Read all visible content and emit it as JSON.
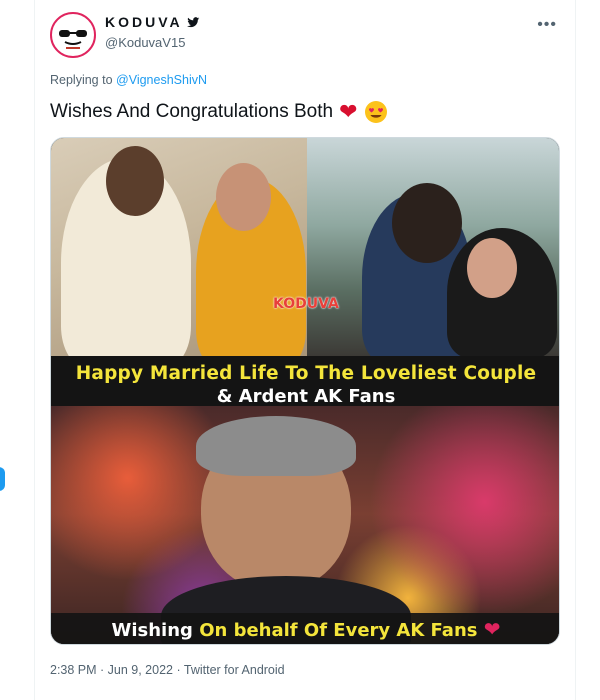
{
  "user": {
    "display_name": "KODUVA",
    "handle": "@KoduvaV15"
  },
  "reply": {
    "prefix": "Replying to",
    "target": "@VigneshShivN"
  },
  "tweet": {
    "text": "Wishes And Congratulations Both"
  },
  "media": {
    "watermark": "KODUVA",
    "caption_line1": "Happy Married Life To The Loveliest Couple",
    "caption_line2": "& Ardent AK Fans",
    "caption2_white": "Wishing",
    "caption2_yellow": "On behalf Of Every AK Fans"
  },
  "meta": {
    "timestamp": "2:38 PM · Jun 9, 2022 · Twitter for Android"
  },
  "colors": {
    "link": "#1d9bf0",
    "secondary_text": "#536471",
    "caption_yellow": "#f4e53b",
    "heart_red": "#d80f2f"
  },
  "icons": [
    "verified-badge-icon",
    "more-options-icon",
    "red-heart-emoji-icon",
    "heart-eyes-emoji-icon"
  ]
}
